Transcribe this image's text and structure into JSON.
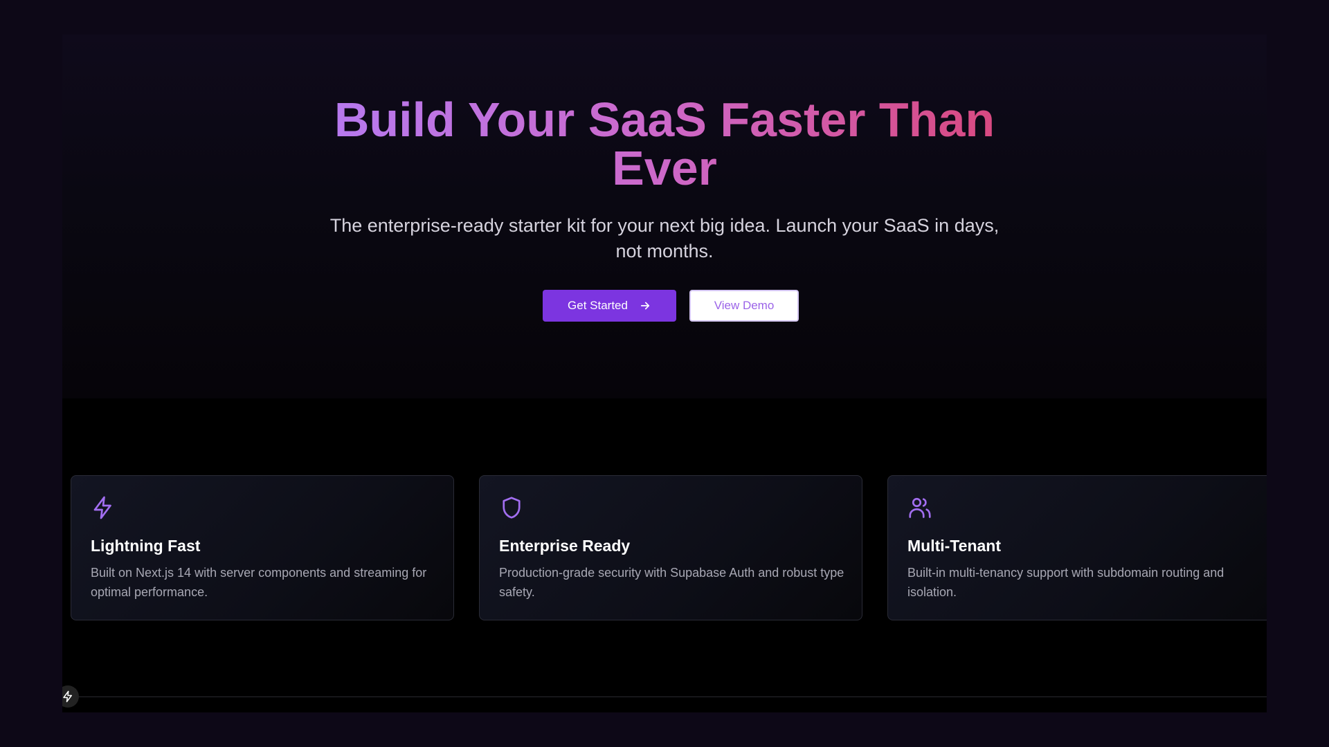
{
  "hero": {
    "title": "Build Your SaaS Faster Than Ever",
    "subtitle": "The enterprise-ready starter kit for your next big idea. Launch your SaaS in days, not months.",
    "primary_button": {
      "label": "Get Started",
      "icon": "arrow-right-icon"
    },
    "secondary_button": {
      "label": "View Demo"
    }
  },
  "features": [
    {
      "icon": "lightning-icon",
      "title": "Lightning Fast",
      "description": "Built on Next.js 14 with server components and streaming for optimal performance."
    },
    {
      "icon": "shield-icon",
      "title": "Enterprise Ready",
      "description": "Production-grade security with Supabase Auth and robust type safety."
    },
    {
      "icon": "users-icon",
      "title": "Multi-Tenant",
      "description": "Built-in multi-tenancy support with subdomain routing and isolation."
    }
  ],
  "footer": {
    "icon": "lightning-icon"
  },
  "colors": {
    "accent": "#7c35e0",
    "icon": "#a26ef0",
    "gradient_start": "#b67af0",
    "gradient_end": "#d9487d"
  }
}
